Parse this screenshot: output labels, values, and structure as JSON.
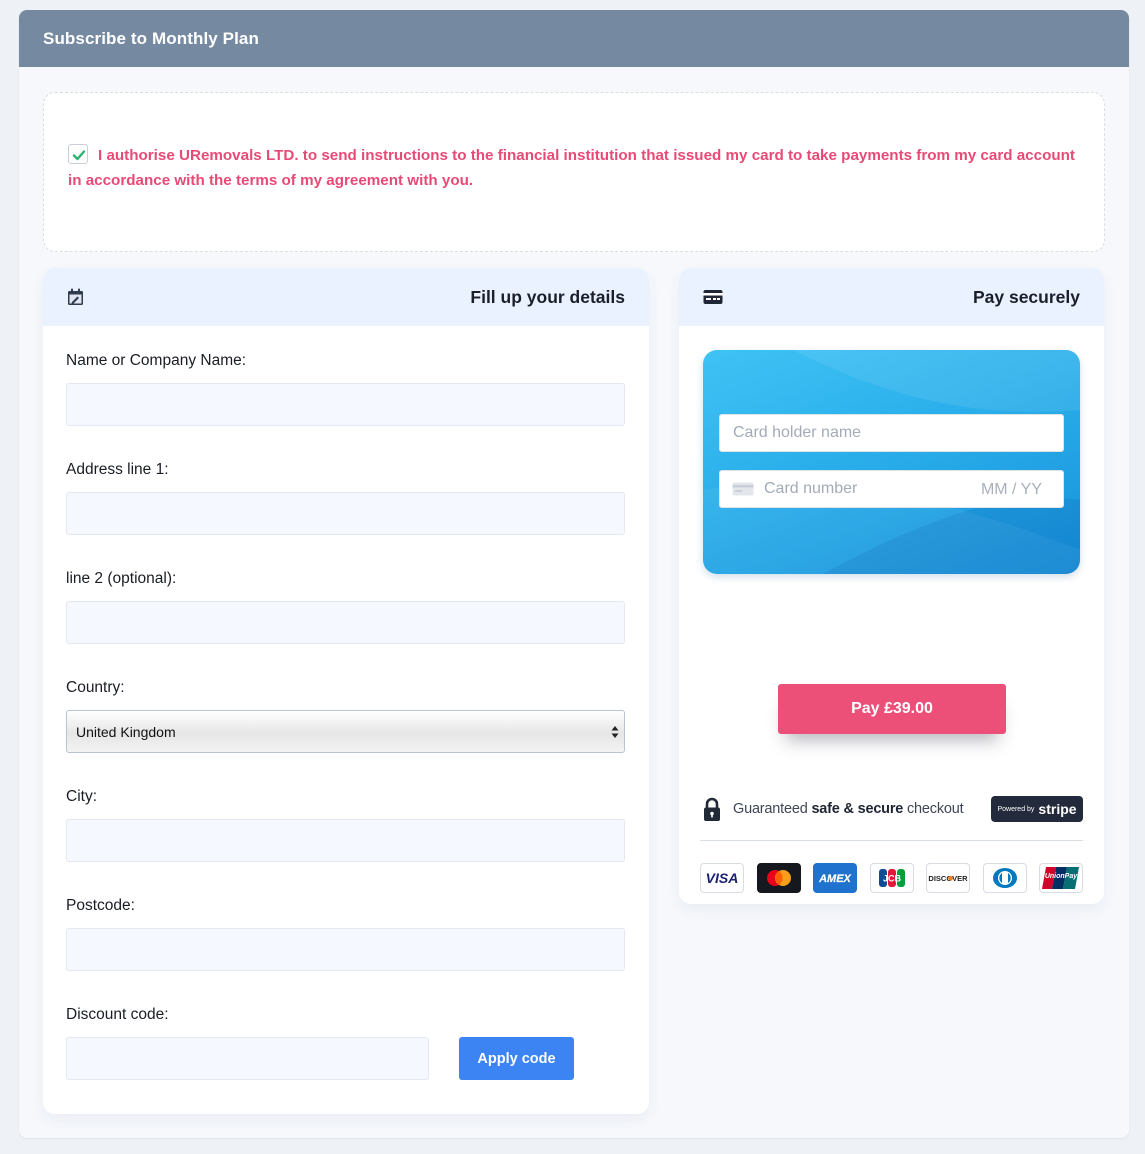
{
  "header": {
    "title": "Subscribe to Monthly Plan"
  },
  "authorisation": {
    "checked": true,
    "text": "I authorise URemovals LTD. to send instructions to the financial institution that issued my card to take payments from my card account in accordance with the terms of my agreement with you."
  },
  "details": {
    "title": "Fill up your details",
    "icon": "calendar-edit-icon",
    "fields": {
      "name_label": "Name or Company Name:",
      "address1_label": "Address line 1:",
      "address2_label": "line 2 (optional):",
      "country_label": "Country:",
      "country_value": "United Kingdom",
      "city_label": "City:",
      "postcode_label": "Postcode:"
    },
    "discount": {
      "label": "Discount code:",
      "button_label": "Apply code"
    }
  },
  "payment": {
    "title": "Pay securely",
    "icon": "credit-card-icon",
    "card": {
      "holder_placeholder": "Card holder name",
      "number_placeholder": "Card number",
      "expiry_placeholder": "MM / YY"
    },
    "pay_button_label": "Pay £39.00",
    "secure": {
      "prefix": "Guaranteed",
      "emphasis": "safe & secure",
      "suffix": "checkout",
      "badge_small": "Powered by",
      "badge_brand": "stripe"
    },
    "brands": [
      "VISA",
      "Mastercard",
      "AMEX",
      "JCB",
      "DISCOVER",
      "Diners Club",
      "UnionPay"
    ]
  },
  "colors": {
    "header_bg": "#758aa0",
    "accent_pink": "#ec5079",
    "apply_blue": "#3c84f4",
    "panel_head_bg": "#ebf2ff"
  }
}
